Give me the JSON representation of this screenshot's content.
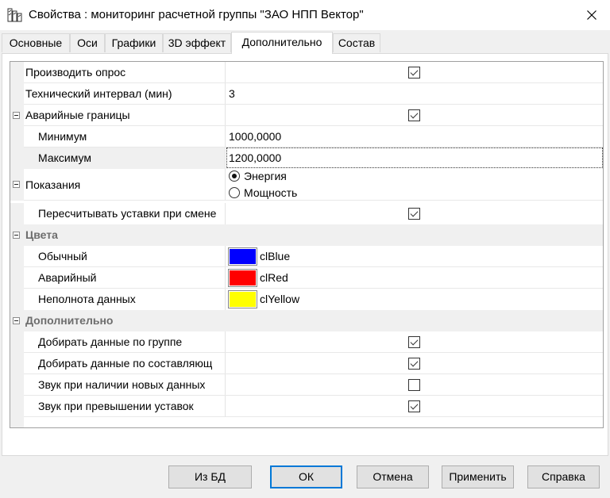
{
  "window": {
    "title": "Свойства : мониторинг расчетной группы \"ЗАО НПП Вектор\""
  },
  "tabs": [
    {
      "label": "Основные"
    },
    {
      "label": "Оси"
    },
    {
      "label": "Графики"
    },
    {
      "label": "3D эффект"
    },
    {
      "label": "Дополнительно",
      "active": true
    },
    {
      "label": "Состав"
    }
  ],
  "grid": {
    "poll": {
      "label": "Производить опрос",
      "checked": true
    },
    "interval": {
      "label": "Технический интервал (мин)",
      "value": "3"
    },
    "alarm": {
      "label": "Аварийные границы",
      "checked": true,
      "min": {
        "label": "Минимум",
        "value": "1000,0000"
      },
      "max": {
        "label": "Максимум",
        "value": "1200,0000"
      }
    },
    "readings": {
      "label": "Показания",
      "options": [
        {
          "label": "Энергия",
          "selected": true
        },
        {
          "label": "Мощность",
          "selected": false
        }
      ],
      "recalc": {
        "label": "Пересчитывать уставки при смене",
        "checked": true
      }
    },
    "colors": {
      "label": "Цвета",
      "normal": {
        "label": "Обычный",
        "value": "clBlue",
        "color": "#0000ff"
      },
      "alarm": {
        "label": "Аварийный",
        "value": "clRed",
        "color": "#ff0000"
      },
      "incomplete": {
        "label": "Неполнота данных",
        "value": "clYellow",
        "color": "#ffff00"
      }
    },
    "extra": {
      "label": "Дополнительно",
      "group_data": {
        "label": "Добирать данные по группе",
        "checked": true
      },
      "component_data": {
        "label": "Добирать данные по составляющ",
        "checked": true
      },
      "sound_new": {
        "label": "Звук при наличии новых данных",
        "checked": false
      },
      "sound_exceed": {
        "label": "Звук при превышении уставок",
        "checked": true
      }
    }
  },
  "buttons": {
    "from_db": "Из БД",
    "ok": "ОК",
    "cancel": "Отмена",
    "apply": "Применить",
    "help": "Справка"
  }
}
